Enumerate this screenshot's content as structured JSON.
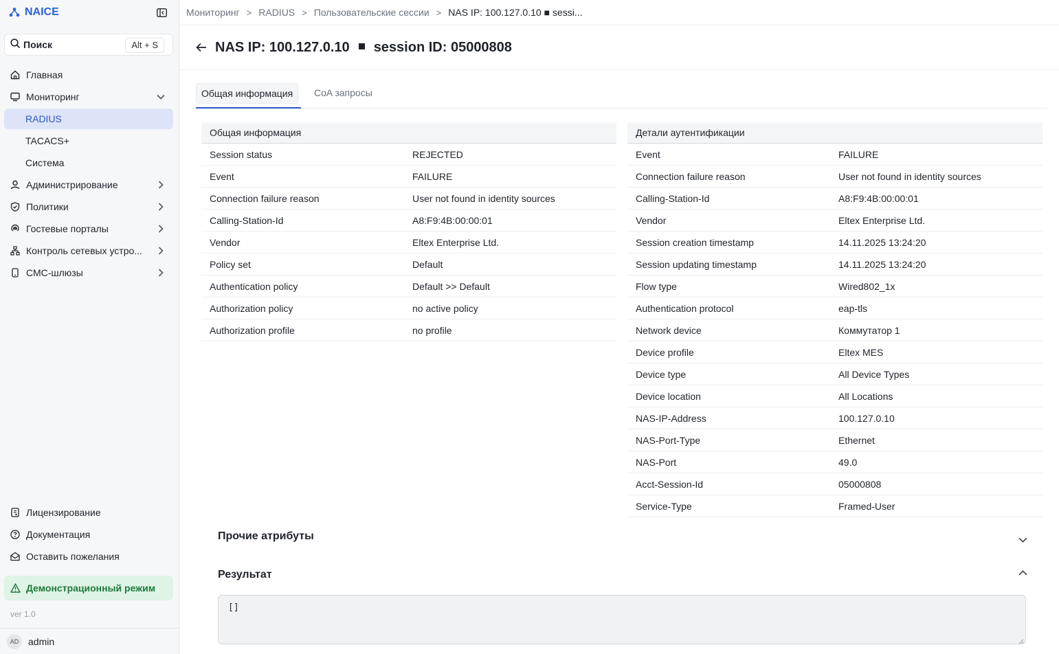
{
  "app": {
    "name": "NAICE"
  },
  "search": {
    "label": "Поиск",
    "shortcut": "Alt + S"
  },
  "sidebar": {
    "items": [
      {
        "label": "Главная"
      },
      {
        "label": "Мониторинг"
      },
      {
        "label": "RADIUS"
      },
      {
        "label": "TACACS+"
      },
      {
        "label": "Система"
      },
      {
        "label": "Администрирование"
      },
      {
        "label": "Политики"
      },
      {
        "label": "Гостевые порталы"
      },
      {
        "label": "Контроль сетевых устро..."
      },
      {
        "label": "СМС-шлюзы"
      }
    ],
    "bottom": [
      {
        "label": "Лицензирование"
      },
      {
        "label": "Документация"
      },
      {
        "label": "Оставить пожелания"
      }
    ],
    "demo_mode": "Демонстрационный режим",
    "version": "ver 1.0",
    "user": {
      "initials": "AD",
      "name": "admin"
    }
  },
  "breadcrumb": {
    "items": [
      "Мониторинг",
      "RADIUS",
      "Пользовательские сессии"
    ],
    "current": "NAS IP: 100.127.0.10 ■ sessi..."
  },
  "page": {
    "title_left": "NAS IP: 100.127.0.10",
    "title_right": "session ID: 05000808"
  },
  "tabs": [
    {
      "label": "Общая информация"
    },
    {
      "label": "CoA запросы"
    }
  ],
  "general": {
    "title": "Общая информация",
    "rows": [
      {
        "k": "Session status",
        "v": "REJECTED"
      },
      {
        "k": "Event",
        "v": "FAILURE"
      },
      {
        "k": "Connection failure reason",
        "v": "User not found in identity sources"
      },
      {
        "k": "Calling-Station-Id",
        "v": "A8:F9:4B:00:00:01"
      },
      {
        "k": "Vendor",
        "v": "Eltex Enterprise Ltd."
      },
      {
        "k": "Policy set",
        "v": "Default"
      },
      {
        "k": "Authentication policy",
        "v": "Default >> Default"
      },
      {
        "k": "Authorization policy",
        "v": "no active policy"
      },
      {
        "k": "Authorization profile",
        "v": "no profile"
      }
    ]
  },
  "auth": {
    "title": "Детали аутентификации",
    "rows": [
      {
        "k": "Event",
        "v": "FAILURE"
      },
      {
        "k": "Connection failure reason",
        "v": "User not found in identity sources"
      },
      {
        "k": "Calling-Station-Id",
        "v": "A8:F9:4B:00:00:01"
      },
      {
        "k": "Vendor",
        "v": "Eltex Enterprise Ltd."
      },
      {
        "k": "Session creation timestamp",
        "v": "14.11.2025 13:24:20"
      },
      {
        "k": "Session updating timestamp",
        "v": "14.11.2025 13:24:20"
      },
      {
        "k": "Flow type",
        "v": "Wired802_1x"
      },
      {
        "k": "Authentication protocol",
        "v": "eap-tls"
      },
      {
        "k": "Network device",
        "v": "Коммутатор 1"
      },
      {
        "k": "Device profile",
        "v": "Eltex MES"
      },
      {
        "k": "Device type",
        "v": "All Device Types"
      },
      {
        "k": "Device location",
        "v": "All Locations"
      },
      {
        "k": "NAS-IP-Address",
        "v": "100.127.0.10"
      },
      {
        "k": "NAS-Port-Type",
        "v": "Ethernet"
      },
      {
        "k": "NAS-Port",
        "v": "49.0"
      },
      {
        "k": "Acct-Session-Id",
        "v": "05000808"
      },
      {
        "k": "Service-Type",
        "v": "Framed-User"
      }
    ]
  },
  "sections": {
    "other_attributes": "Прочие атрибуты",
    "result": "Результат",
    "result_value": "[]"
  },
  "colors": {
    "accent": "#2a56c6",
    "active_bg": "#dde4f7",
    "demo_bg": "#dff3e6",
    "demo_fg": "#1d7a3c"
  }
}
